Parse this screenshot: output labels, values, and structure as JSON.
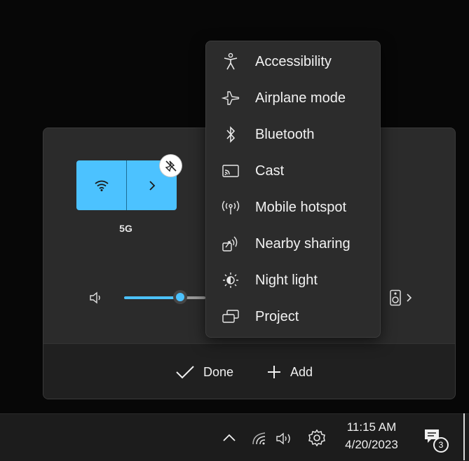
{
  "quick_settings": {
    "wifi_tile": {
      "label": "5G",
      "icon": "wifi-icon",
      "expand_icon": "chevron-right-icon",
      "unpin_icon": "unpin-icon",
      "accent_color": "#4cc2ff"
    },
    "volume": {
      "icon": "speaker-icon",
      "level_fraction": 0.43,
      "output_icon": "speaker-device-icon",
      "output_chevron": "chevron-right-icon"
    },
    "footer": {
      "done_label": "Done",
      "add_label": "Add"
    }
  },
  "add_menu": {
    "items": [
      {
        "label": "Accessibility",
        "icon": "accessibility-icon"
      },
      {
        "label": "Airplane mode",
        "icon": "airplane-icon"
      },
      {
        "label": "Bluetooth",
        "icon": "bluetooth-icon"
      },
      {
        "label": "Cast",
        "icon": "cast-icon"
      },
      {
        "label": "Mobile hotspot",
        "icon": "hotspot-icon"
      },
      {
        "label": "Nearby sharing",
        "icon": "nearby-sharing-icon"
      },
      {
        "label": "Night light",
        "icon": "night-light-icon"
      },
      {
        "label": "Project",
        "icon": "project-icon"
      }
    ]
  },
  "taskbar": {
    "time": "11:15 AM",
    "date": "4/20/2023",
    "notification_count": "3",
    "tray_icons": [
      "chevron-up-icon",
      "wifi-icon",
      "volume-icon",
      "settings-gear-icon",
      "notification-icon"
    ]
  }
}
